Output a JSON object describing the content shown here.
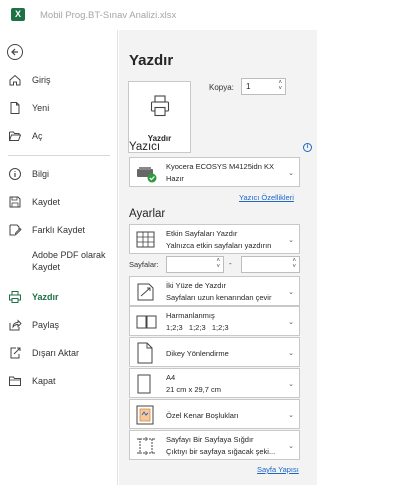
{
  "window": {
    "title": "Mobil Prog.BT-Sınav Analizi.xlsx",
    "app_icon": "excel-icon"
  },
  "sidebar": {
    "items": [
      {
        "label": "Giriş",
        "icon": "home-icon"
      },
      {
        "label": "Yeni",
        "icon": "new-document-icon"
      },
      {
        "label": "Aç",
        "icon": "open-folder-icon"
      },
      {
        "label": "Bilgi",
        "icon": "info-icon"
      },
      {
        "label": "Kaydet",
        "icon": "save-icon"
      },
      {
        "label": "Farklı Kaydet",
        "icon": "save-as-icon"
      },
      {
        "label": "Adobe PDF olarak Kaydet",
        "icon": ""
      },
      {
        "label": "Yazdır",
        "icon": "printer-icon",
        "active": true
      },
      {
        "label": "Paylaş",
        "icon": "share-icon"
      },
      {
        "label": "Dışarı Aktar",
        "icon": "export-icon"
      },
      {
        "label": "Kapat",
        "icon": "close-folder-icon"
      }
    ]
  },
  "print": {
    "title": "Yazdır",
    "button_label": "Yazdır",
    "copies_label": "Kopya:",
    "copies_value": "1",
    "printer_heading": "Yazıcı",
    "printer_name": "Kyocera ECOSYS M4125idn KX",
    "printer_status": "Hazır",
    "printer_properties": "Yazıcı Özellikleri",
    "settings_heading": "Ayarlar",
    "pages_label": "Sayfalar:",
    "pages_dash": "-",
    "page_setup": "Sayfa Yapısı",
    "settings": [
      {
        "line1": "Etkin Sayfaları Yazdır",
        "line2": "Yalnızca etkin sayfaları yazdırın",
        "icon": "sheet-grid-icon"
      },
      {
        "line1": "İki Yüze de Yazdır",
        "line2": "Sayfaları uzun kenarından çevir",
        "icon": "duplex-icon"
      },
      {
        "line1": "Harmanlanmış",
        "line2": "1;2;3   1;2;3   1;2;3",
        "icon": "collated-icon"
      },
      {
        "line1": "Dikey Yönlendirme",
        "line2": "",
        "icon": "portrait-icon"
      },
      {
        "line1": "A4",
        "line2": "21 cm x 29,7 cm",
        "icon": "paper-size-icon"
      },
      {
        "line1": "Özel Kenar Boşlukları",
        "line2": "",
        "icon": "margins-icon"
      },
      {
        "line1": "Sayfayı Bir Sayfaya Sığdır",
        "line2": "Çıktıyı bir sayfaya sığacak şeki...",
        "icon": "fit-to-page-icon"
      }
    ]
  }
}
